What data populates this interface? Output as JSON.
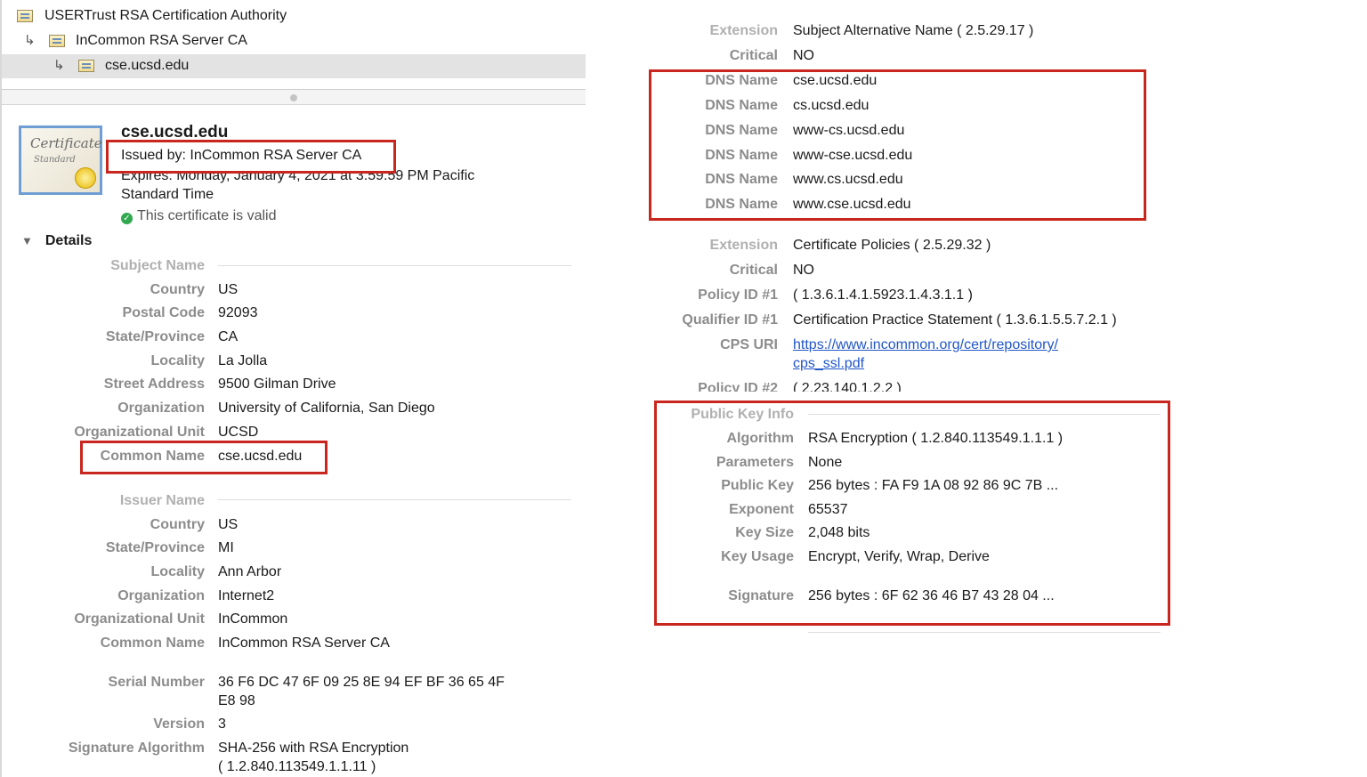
{
  "tree": {
    "items": [
      {
        "label": "USERTrust RSA Certification Authority"
      },
      {
        "label": "InCommon RSA Server CA"
      },
      {
        "label": "cse.ucsd.edu"
      }
    ]
  },
  "cert_header": {
    "icon_text_1": "Certificate",
    "icon_text_2": "Standard",
    "name": "cse.ucsd.edu",
    "issued_by": "Issued by: InCommon RSA Server CA",
    "expires_line1": "Expires: Monday, January 4, 2021 at 3:59:59 PM Pacific",
    "expires_line2": "Standard Time",
    "valid_text": "This certificate is valid",
    "details_label": "Details"
  },
  "subject": {
    "section": "Subject Name",
    "rows": [
      {
        "label": "Country",
        "value": "US"
      },
      {
        "label": "Postal Code",
        "value": "92093"
      },
      {
        "label": "State/Province",
        "value": "CA"
      },
      {
        "label": "Locality",
        "value": "La Jolla"
      },
      {
        "label": "Street Address",
        "value": "9500 Gilman Drive"
      },
      {
        "label": "Organization",
        "value": "University of California, San Diego"
      },
      {
        "label": "Organizational Unit",
        "value": "UCSD"
      },
      {
        "label": "Common Name",
        "value": "cse.ucsd.edu"
      }
    ]
  },
  "issuer": {
    "section": "Issuer Name",
    "rows": [
      {
        "label": "Country",
        "value": "US"
      },
      {
        "label": "State/Province",
        "value": "MI"
      },
      {
        "label": "Locality",
        "value": "Ann Arbor"
      },
      {
        "label": "Organization",
        "value": "Internet2"
      },
      {
        "label": "Organizational Unit",
        "value": "InCommon"
      },
      {
        "label": "Common Name",
        "value": "InCommon RSA Server CA"
      }
    ]
  },
  "misc": {
    "serial_label": "Serial Number",
    "serial_value1": "36 F6 DC 47 6F 09 25 8E 94 EF BF 36 65 4F",
    "serial_value2": "E8 98",
    "version_label": "Version",
    "version_value": "3",
    "sigalg_label": "Signature Algorithm",
    "sigalg_value1": "SHA-256 with RSA Encryption",
    "sigalg_value2": "( 1.2.840.113549.1.1.11 )"
  },
  "san": {
    "ext_label": "Extension",
    "ext_value": "Subject Alternative Name ( 2.5.29.17 )",
    "crit_label": "Critical",
    "crit_value": "NO",
    "dns": [
      {
        "label": "DNS Name",
        "value": "cse.ucsd.edu"
      },
      {
        "label": "DNS Name",
        "value": "cs.ucsd.edu"
      },
      {
        "label": "DNS Name",
        "value": "www-cs.ucsd.edu"
      },
      {
        "label": "DNS Name",
        "value": "www-cse.ucsd.edu"
      },
      {
        "label": "DNS Name",
        "value": "www.cs.ucsd.edu"
      },
      {
        "label": "DNS Name",
        "value": "www.cse.ucsd.edu"
      }
    ]
  },
  "policies": {
    "ext_label": "Extension",
    "ext_value": "Certificate Policies ( 2.5.29.32 )",
    "crit_label": "Critical",
    "crit_value": "NO",
    "p1_label": "Policy ID #1",
    "p1_value": "( 1.3.6.1.4.1.5923.1.4.3.1.1 )",
    "q1_label": "Qualifier ID #1",
    "q1_value": "Certification Practice Statement ( 1.3.6.1.5.5.7.2.1 )",
    "cps_label": "CPS URI",
    "cps_value1": "https://www.incommon.org/cert/repository/",
    "cps_value2": "cps_ssl.pdf",
    "p2_label": "Policy ID #2",
    "p2_value": "( 2.23.140.1.2.2 )"
  },
  "pubkey": {
    "section": "Public Key Info",
    "rows": [
      {
        "label": "Algorithm",
        "value": "RSA Encryption ( 1.2.840.113549.1.1.1 )"
      },
      {
        "label": "Parameters",
        "value": "None"
      },
      {
        "label": "Public Key",
        "value": "256 bytes : FA F9 1A 08 92 86 9C 7B ..."
      },
      {
        "label": "Exponent",
        "value": "65537"
      },
      {
        "label": "Key Size",
        "value": "2,048 bits"
      },
      {
        "label": "Key Usage",
        "value": "Encrypt, Verify, Wrap, Derive"
      }
    ],
    "sig_label": "Signature",
    "sig_value": "256 bytes : 6F 62 36 46 B7 43 28 04 ..."
  }
}
